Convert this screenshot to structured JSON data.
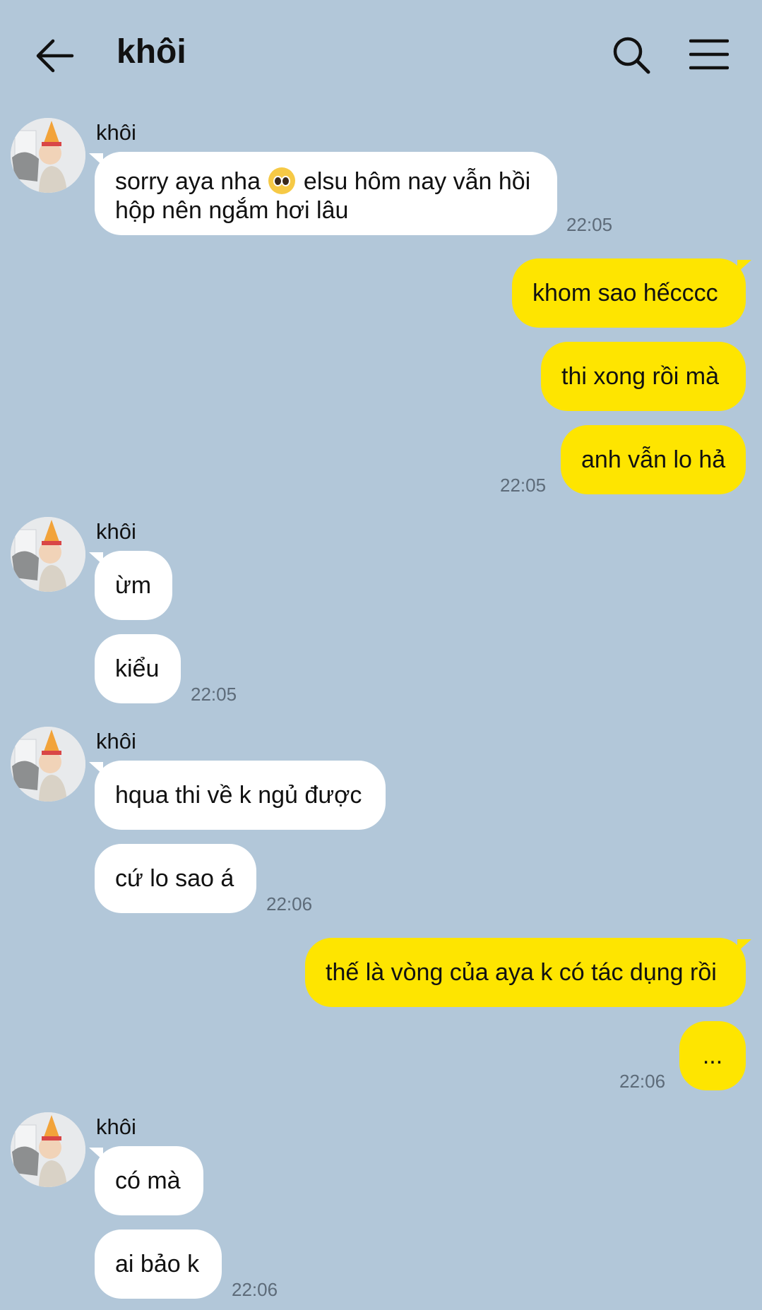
{
  "header": {
    "title": "khôi"
  },
  "icons": {
    "back": "arrow-left-icon",
    "search": "search-icon",
    "menu": "hamburger-menu-icon",
    "emoji": "pleading-face-icon"
  },
  "colors": {
    "background": "#b2c7d9",
    "sent_bubble": "#fee500",
    "received_bubble": "#ffffff"
  },
  "messages": [
    {
      "type": "received",
      "sender": "khôi",
      "text_before_emoji": "sorry aya nha",
      "text_after_emoji": "elsu hôm nay vẫn hồi hộp nên ngắm hơi lâu",
      "time": "22:05"
    },
    {
      "type": "sent",
      "text": "khom sao hếcccc"
    },
    {
      "type": "sent",
      "text": "thi xong rồi mà"
    },
    {
      "type": "sent",
      "text": "anh vẫn lo hả",
      "time": "22:05"
    },
    {
      "type": "received",
      "sender": "khôi",
      "text": "ừm"
    },
    {
      "type": "received",
      "text": "kiểu",
      "time": "22:05"
    },
    {
      "type": "received",
      "sender": "khôi",
      "text": "hqua thi về k ngủ được"
    },
    {
      "type": "received",
      "text": "cứ lo sao á",
      "time": "22:06"
    },
    {
      "type": "sent",
      "text": "thế là vòng của aya k có tác dụng rồi"
    },
    {
      "type": "sent",
      "text": "...",
      "time": "22:06"
    },
    {
      "type": "received",
      "sender": "khôi",
      "text": "có mà"
    },
    {
      "type": "received",
      "text": "ai bảo k",
      "time": "22:06"
    }
  ]
}
